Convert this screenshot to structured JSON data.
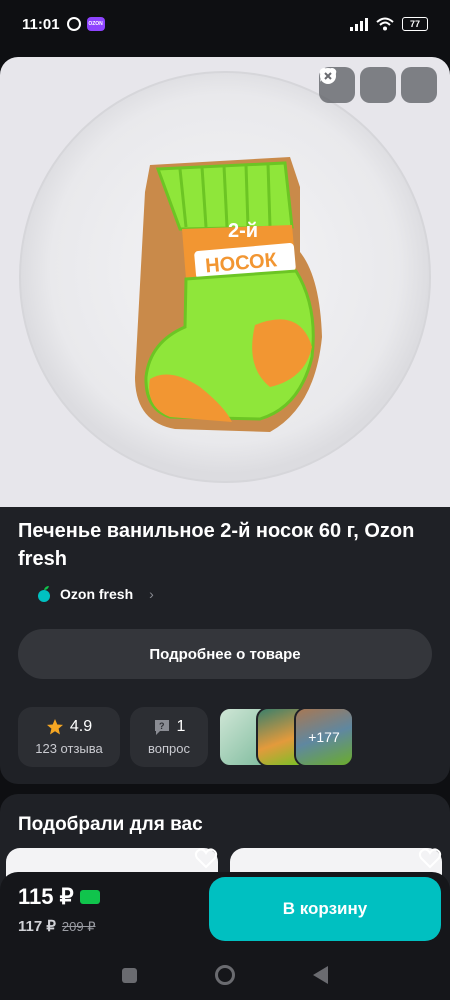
{
  "status_bar": {
    "time": "11:01",
    "ozon_badge": "OZON",
    "battery": "77"
  },
  "product": {
    "title": "Печенье ванильное 2-й носок 60 г, Ozon fresh",
    "image_text_line1": "2-й",
    "image_text_line2": "НОСОК",
    "brand": "Ozon fresh",
    "details_button": "Подробнее о товаре",
    "rating": "4.9",
    "reviews": "123 отзыва",
    "questions_count": "1",
    "questions_label": "вопрос",
    "photos_more": "+177"
  },
  "recommendations": {
    "title": "Подобрали для вас"
  },
  "purchase": {
    "price": "115 ₽",
    "member_price": "117 ₽",
    "old_price": "209 ₽",
    "cart_button": "В корзину"
  },
  "colors": {
    "accent": "#00c0c1",
    "card_bg": "#1f2126",
    "page_bg": "#0e0f12",
    "price_card": "#10c44c",
    "star": "#f5a623"
  },
  "icons": [
    "alarm-icon",
    "wifi-icon",
    "battery-icon",
    "heart-icon",
    "share-icon",
    "close-icon",
    "star-icon",
    "question-icon",
    "chevron-right-icon",
    "ozon-fresh-logo-icon"
  ]
}
